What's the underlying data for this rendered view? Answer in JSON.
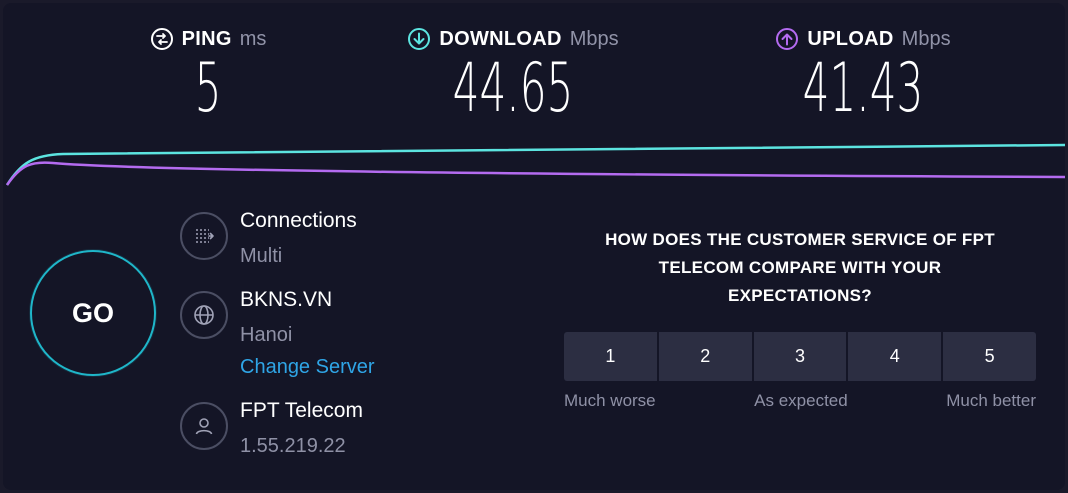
{
  "colors": {
    "download": "#5ce4e0",
    "upload": "#b46bf0",
    "go_ring": "#1fb6c9",
    "link": "#2fa5e6"
  },
  "metrics": {
    "ping": {
      "label": "PING",
      "unit": "ms",
      "value": "5",
      "icon": "ping-icon"
    },
    "download": {
      "label": "DOWNLOAD",
      "unit": "Mbps",
      "value": "44.65",
      "icon": "download-arrow-icon"
    },
    "upload": {
      "label": "UPLOAD",
      "unit": "Mbps",
      "value": "41.43",
      "icon": "upload-arrow-icon"
    }
  },
  "go_label": "GO",
  "connections": {
    "title": "Connections",
    "value": "Multi",
    "icon": "connections-icon"
  },
  "server": {
    "name": "BKNS.VN",
    "location": "Hanoi",
    "change_label": "Change Server",
    "icon": "globe-icon"
  },
  "isp": {
    "name": "FPT Telecom",
    "ip": "1.55.219.22",
    "icon": "user-icon"
  },
  "survey": {
    "question": "HOW DOES THE CUSTOMER SERVICE OF FPT TELECOM COMPARE WITH YOUR EXPECTATIONS?",
    "options": [
      "1",
      "2",
      "3",
      "4",
      "5"
    ],
    "scale": {
      "low": "Much worse",
      "mid": "As expected",
      "high": "Much better"
    }
  }
}
